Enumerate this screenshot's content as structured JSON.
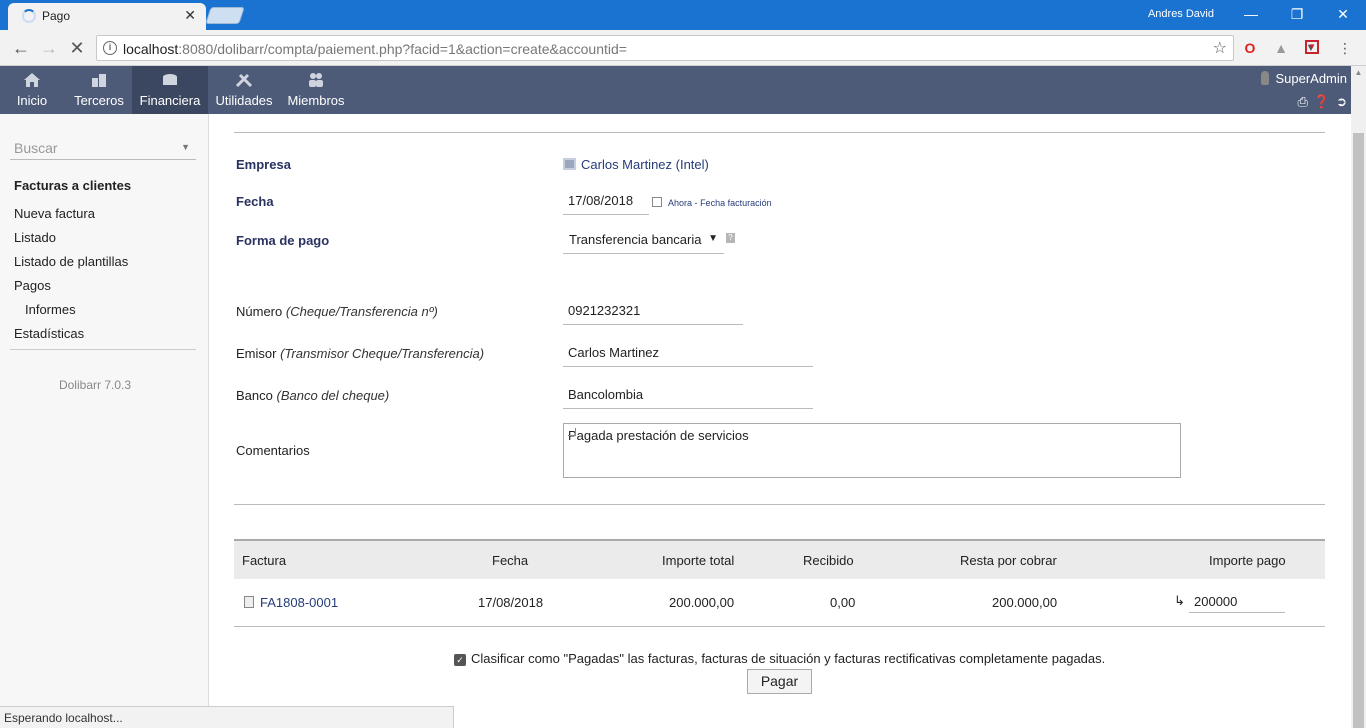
{
  "browser": {
    "tab_title": "Pago",
    "tab_close": "✕",
    "window_user": "Andres David",
    "url_host": "localhost",
    "url_rest": ":8080/dolibarr/compta/paiement.php?facid=1&action=create&accountid=",
    "status_text": "Esperando localhost..."
  },
  "topmenu": {
    "items": [
      {
        "label": "Inicio",
        "icon": "home-icon"
      },
      {
        "label": "Terceros",
        "icon": "building-icon"
      },
      {
        "label": "Financiera",
        "icon": "coins-icon"
      },
      {
        "label": "Utilidades",
        "icon": "tools-icon"
      },
      {
        "label": "Miembros",
        "icon": "members-icon"
      }
    ],
    "active": "Financiera",
    "user": "SuperAdmin"
  },
  "sidebar": {
    "search_placeholder": "Buscar",
    "heading": "Facturas a clientes",
    "links": [
      "Nueva factura",
      "Listado",
      "Listado de plantillas",
      "Pagos",
      "Informes",
      "Estadísticas"
    ],
    "version": "Dolibarr 7.0.3"
  },
  "form": {
    "empresa_label": "Empresa",
    "empresa_value": "Carlos Martinez (Intel)",
    "fecha_label": "Fecha",
    "fecha_value": "17/08/2018",
    "ahora_link": "Ahora",
    "fecha_sep": "-",
    "fecha_facturacion_link": "Fecha facturación",
    "forma_pago_label": "Forma de pago",
    "forma_pago_value": "Transferencia bancaria",
    "numero_label": "Número",
    "numero_hint": "(Cheque/Transferencia nº)",
    "numero_value": "0921232321",
    "emisor_label": "Emisor",
    "emisor_hint": "(Transmisor Cheque/Transferencia)",
    "emisor_value": "Carlos Martinez",
    "banco_label": "Banco",
    "banco_hint": "(Banco del cheque)",
    "banco_value": "Bancolombia",
    "comentarios_label": "Comentarios",
    "comentarios_value": "Pagada prestación de servicios"
  },
  "table": {
    "headers": {
      "factura": "Factura",
      "fecha": "Fecha",
      "importe_total": "Importe total",
      "recibido": "Recibido",
      "resta": "Resta por cobrar",
      "importe_pago": "Importe pago"
    },
    "rows": [
      {
        "factura": "FA1808-0001",
        "fecha": "17/08/2018",
        "importe_total": "200.000,00",
        "recibido": "0,00",
        "resta": "200.000,00",
        "importe_pago": "200000"
      }
    ]
  },
  "footer": {
    "checkbox_label": "Clasificar como \"Pagadas\" las facturas, facturas de situación y facturas rectificativas completamente pagadas.",
    "checked": true,
    "pay_button": "Pagar"
  },
  "colors": {
    "topmenu_bg": "#4e5b78",
    "topmenu_active": "#3b4660",
    "chrome_blue": "#1b73d1",
    "link": "#263c7a"
  }
}
